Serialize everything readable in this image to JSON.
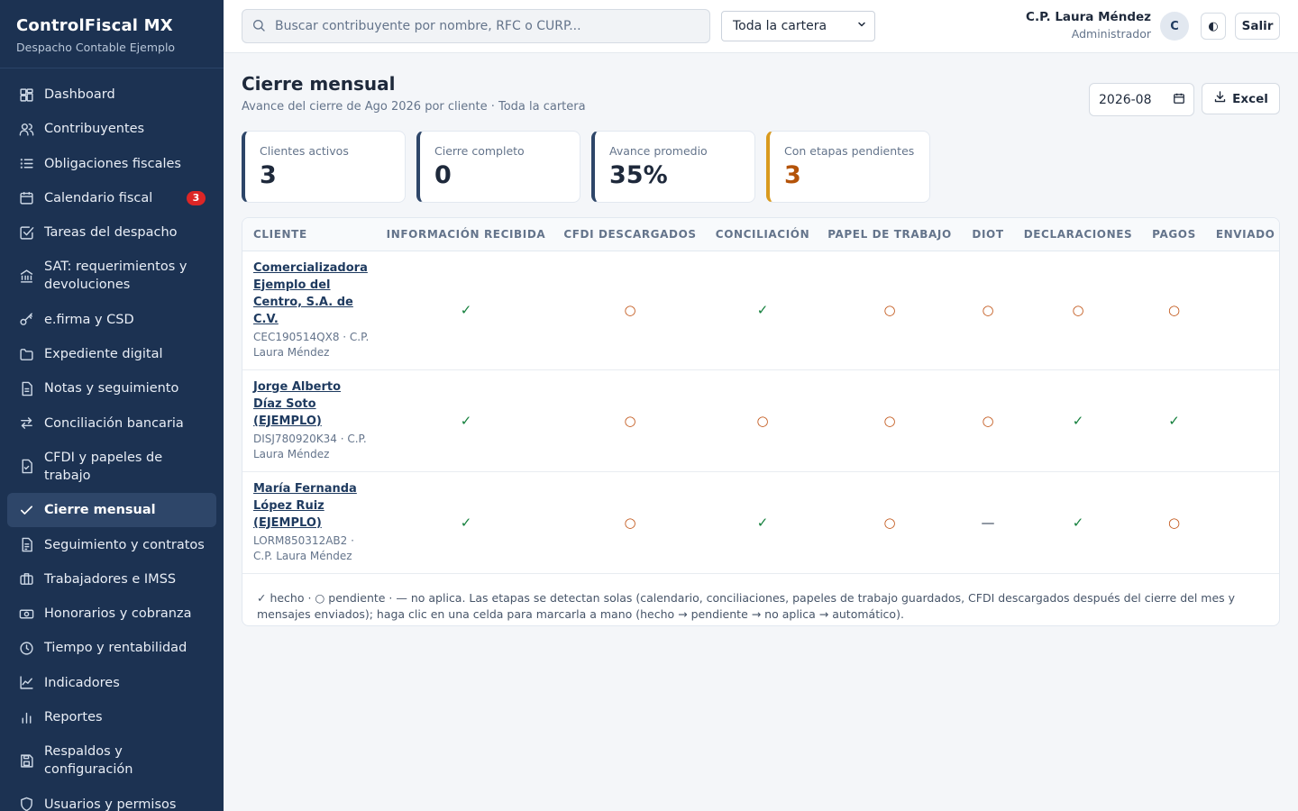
{
  "brand": {
    "title": "ControlFiscal MX",
    "subtitle": "Despacho Contable Ejemplo"
  },
  "sidebar": {
    "items": [
      {
        "label": "Dashboard",
        "icon": "dashboard-icon"
      },
      {
        "label": "Contribuyentes",
        "icon": "users-icon"
      },
      {
        "label": "Obligaciones fiscales",
        "icon": "list-icon"
      },
      {
        "label": "Calendario fiscal",
        "icon": "calendar-icon",
        "badge": "3"
      },
      {
        "label": "Tareas del despacho",
        "icon": "checkbox-icon"
      },
      {
        "label": "SAT: requerimientos y devoluciones",
        "icon": "bank-icon"
      },
      {
        "label": "e.firma y CSD",
        "icon": "key-icon"
      },
      {
        "label": "Expediente digital",
        "icon": "folder-icon"
      },
      {
        "label": "Notas y seguimiento",
        "icon": "note-icon"
      },
      {
        "label": "Conciliación bancaria",
        "icon": "arrows-icon"
      },
      {
        "label": "CFDI y papeles de trabajo",
        "icon": "file-check-icon"
      },
      {
        "label": "Cierre mensual",
        "icon": "check-icon",
        "active": true
      },
      {
        "label": "Seguimiento y contratos",
        "icon": "document-icon"
      },
      {
        "label": "Trabajadores e IMSS",
        "icon": "briefcase-icon"
      },
      {
        "label": "Honorarios y cobranza",
        "icon": "money-icon"
      },
      {
        "label": "Tiempo y rentabilidad",
        "icon": "clock-icon"
      },
      {
        "label": "Indicadores",
        "icon": "line-chart-icon"
      },
      {
        "label": "Reportes",
        "icon": "bar-chart-icon"
      },
      {
        "label": "Respaldos y configuración",
        "icon": "save-icon"
      },
      {
        "label": "Usuarios y permisos",
        "icon": "shield-icon"
      }
    ]
  },
  "topbar": {
    "search_placeholder": "Buscar contribuyente por nombre, RFC o CURP...",
    "scope_value": "Toda la cartera",
    "user_name": "C.P. Laura Méndez",
    "user_role": "Administrador",
    "avatar_initial": "C",
    "theme_glyph": "◐",
    "logout_label": "Salir"
  },
  "page": {
    "title": "Cierre mensual",
    "subtitle": "Avance del cierre de Ago 2026 por cliente · Toda la cartera",
    "month_value": "2026-08",
    "excel_label": "Excel"
  },
  "cards": [
    {
      "label": "Clientes activos",
      "value": "3"
    },
    {
      "label": "Cierre completo",
      "value": "0"
    },
    {
      "label": "Avance promedio",
      "value": "35%"
    },
    {
      "label": "Con etapas pendientes",
      "value": "3",
      "warn": true
    }
  ],
  "table": {
    "columns": [
      "CLIENTE",
      "INFORMACIÓN RECIBIDA",
      "CFDI DESCARGADOS",
      "CONCILIACIÓN",
      "PAPEL DE TRABAJO",
      "DIOT",
      "DECLARACIONES",
      "PAGOS",
      "ENVIADO A"
    ],
    "rows": [
      {
        "name": "Comercializadora Ejemplo del Centro, S.A. de C.V.",
        "meta": "CEC190514QX8 · C.P. Laura Méndez",
        "states": [
          "done",
          "pend",
          "done",
          "pend",
          "pend",
          "pend",
          "pend",
          "pend"
        ]
      },
      {
        "name": "Jorge Alberto Díaz Soto (EJEMPLO)",
        "meta": "DISJ780920K34 · C.P. Laura Méndez",
        "states": [
          "done",
          "pend",
          "pend",
          "pend",
          "pend",
          "done",
          "done",
          "pend"
        ]
      },
      {
        "name": "María Fernanda López Ruiz (EJEMPLO)",
        "meta": "LORM850312AB2 · C.P. Laura Méndez",
        "states": [
          "done",
          "pend",
          "done",
          "pend",
          "na",
          "done",
          "pend",
          "pend"
        ]
      }
    ],
    "symbols": {
      "done": "✓",
      "pend": "○",
      "na": "—"
    },
    "legend": "✓ hecho · ○ pendiente · — no aplica. Las etapas se detectan solas (calendario, conciliaciones, papeles de trabajo guardados, CFDI descargados después del cierre del mes y mensajes enviados); haga clic en una celda para marcarla a mano (hecho → pendiente → no aplica → automático)."
  }
}
